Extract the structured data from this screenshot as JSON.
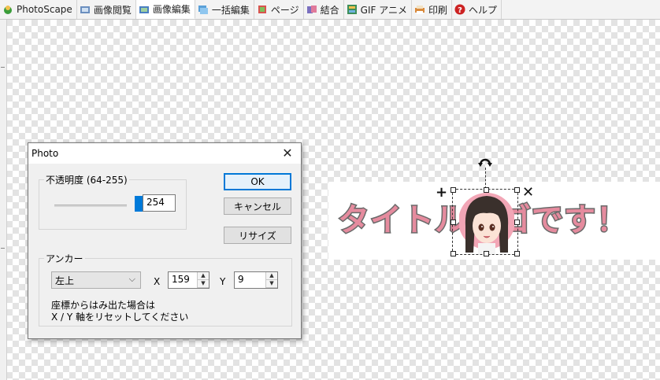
{
  "tabs": [
    {
      "label": "PhotoScape",
      "icon": "photoscape-icon",
      "color": "#3a9d3a"
    },
    {
      "label": "画像閲覧",
      "icon": "viewer-icon",
      "color": "#6b8fbf"
    },
    {
      "label": "画像編集",
      "icon": "editor-icon",
      "color": "#4a7fc1",
      "active": true
    },
    {
      "label": "一括編集",
      "icon": "batch-editor-icon",
      "color": "#5aa0d8"
    },
    {
      "label": "ページ",
      "icon": "page-icon",
      "color": "#d9534f"
    },
    {
      "label": "結合",
      "icon": "combine-icon",
      "color": "#7a6fbf"
    },
    {
      "label": "GIF アニメ",
      "icon": "gif-animation-icon",
      "color": "#3d8f5a"
    },
    {
      "label": "印刷",
      "icon": "print-icon",
      "color": "#d98a3c"
    },
    {
      "label": "ヘルプ",
      "icon": "help-icon",
      "color": "#cc2222"
    }
  ],
  "canvas": {
    "banner_text": "タイトルロゴです！",
    "banner_text_color": "#e58b9e",
    "banner_outline_color": "#6a6a6a"
  },
  "dialog": {
    "title": "Photo",
    "opacity_group_label": "不透明度 (64-255)",
    "opacity_value": "254",
    "opacity_level": 254,
    "ok_label": "OK",
    "cancel_label": "キャンセル",
    "resize_label": "リサイズ",
    "anchor_group_label": "アンカー",
    "anchor_selected": "左上",
    "x_label": "X",
    "x_value": "159",
    "y_label": "Y",
    "y_value": "9",
    "note_line1": "座標からはみ出た場合は",
    "note_line2": "X / Y 軸をリセットしてください"
  },
  "colors": {
    "accent": "#0078d7",
    "slider_thumb": "#007ad9"
  }
}
